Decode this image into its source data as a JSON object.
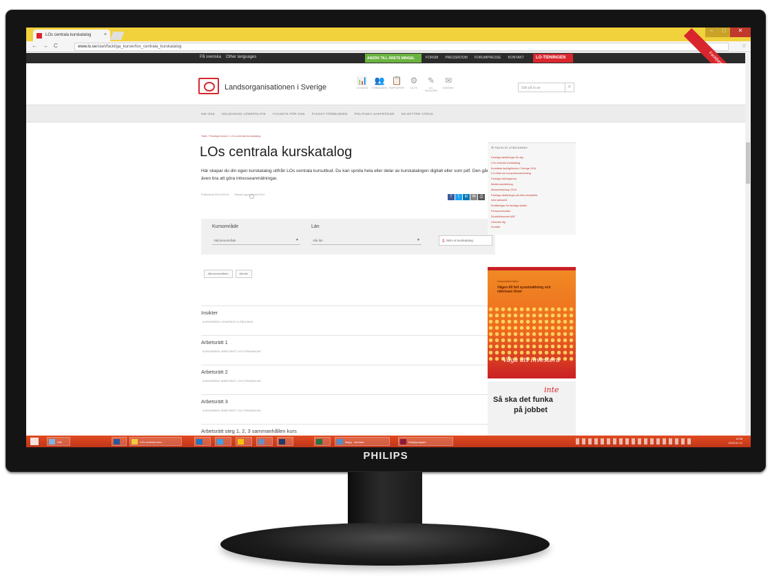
{
  "browser": {
    "tab_title": "LOs centrala kurskatalog",
    "tab_close": "×",
    "url_host": "www.lo.se",
    "url_path": "/start/fackliga_kurser/los_centrala_kurskatalog",
    "nav_back": "←",
    "nav_forward": "→",
    "nav_reload": "C"
  },
  "topbar": {
    "link1": "På svenska",
    "link2": "Other languages",
    "green_button": "ANSÖK TILL ÅRETS MINGEL",
    "links": [
      "FORUM",
      "PRESSROOM",
      "FORUMPRESSE",
      "KONTAKT"
    ],
    "red_button": "LO-TIDNINGEN"
  },
  "ribbon": "Fackfjantakyrkan.se",
  "header": {
    "logo_text": "Landsorganisationen i Sverige",
    "icons": [
      {
        "glyph": "📊",
        "label": "LO-FAKTA"
      },
      {
        "glyph": "👥",
        "label": "FÖRBUNDEN"
      },
      {
        "glyph": "📋",
        "label": "RAPPORTER"
      },
      {
        "glyph": "⚙",
        "label": "LO-TV"
      },
      {
        "glyph": "✎",
        "label": "LO-BLOGGEN"
      },
      {
        "glyph": "✉",
        "label": "KONTAKT"
      }
    ],
    "search_placeholder": "Sök på lo.se",
    "search_icon": "⌕"
  },
  "mainnav": {
    "items": [
      "OM OSS",
      "SOLIDARISK LÖNEPOLITIK",
      "FACKETS FÖR OSS",
      "FACKET FÖRBUNDEN",
      "POLITISKA SAKFRÅGOR",
      "EN BÄTTRE VÄRLD"
    ]
  },
  "content": {
    "breadcrumb": "Start / Fackliga kurser / LOs centrala kurskatalog",
    "title": "LOs centrala kurskatalog",
    "intro": "Här skapar du din egen kurskatalog utifrån LOs centrala kursutbud. Du kan sprida hela eller delar av kurskatalogen digitalt eller som pdf. Den går även bra att göra intresseanmälningar.",
    "meta_left": "Publicerad 2014-09-09",
    "meta_right": "Senast uppdaterad 2014",
    "share_colors": [
      "#3b5998",
      "#1da1f2",
      "#0077b5",
      "#888888",
      "#555555"
    ]
  },
  "filter": {
    "label1": "Kursområde",
    "select1": "Välj kursområde",
    "label2": "Län",
    "select2": "Alla län",
    "caret": "▼",
    "print_label": "Skriv ut kurskatalog",
    "pill1": "Alla kursområden",
    "pill2": "Alla län"
  },
  "courses": [
    {
      "title": "Insikter",
      "sub": "KURSOMRÅDE: LEDARSKAP & UTBILDNING"
    },
    {
      "title": "Arbetsrätt 1",
      "sub": "KURSOMRÅDE: ARBETSRÄTT OCH FÖRHANDLING"
    },
    {
      "title": "Arbetsrätt 2",
      "sub": "KURSOMRÅDE: ARBETSRÄTT OCH FÖRHANDLING"
    },
    {
      "title": "Arbetsrätt 3",
      "sub": "KURSOMRÅDE: ARBETSRÄTT OCH FÖRHANDLING"
    },
    {
      "title": "Arbetsrätt steg 1, 2, 3 sammanhållen kurs",
      "sub": ""
    }
  ],
  "sidebar": {
    "heading": "FACKLIG UTBILDNING",
    "items": [
      "Fackliga utbildningar för dig",
      "LOs centrala kurskatalog",
      "Kursfakta fackligt/skolor i Sverige 2015",
      "LO-rådet om kompetensutveckling",
      "Fackliga folkhögskolor",
      "Medlemsutbildning",
      "Medarbetarskap 2015",
      "Fackliga utbildningar på olika ortsdistrikt",
      "Internationellt",
      "Ersättningar för fackliga studier",
      "Förtroendevalda",
      "Studieförbundet ABF",
      "Utveckla dig",
      "Kontakt"
    ]
  },
  "ads": {
    "ad1_small": "Kampanjinformation",
    "ad1_big": "Vägen till full sysselsättning och rättvisare löner",
    "ad1_script": "Våga att investera",
    "ad2_inte": "inte",
    "ad2_line1": "Så ska det funka",
    "ad2_line2": "på jobbet"
  },
  "taskbar": {
    "items": [
      "Sök",
      "LOs centrala kurs...",
      "Word",
      "Explorer",
      "Foton",
      "Photoshop",
      "Excel",
      "Mapp - skrivare",
      "Kalkylprogram"
    ],
    "time": "10:38",
    "date": "2015-01-12"
  },
  "monitor_brand": "PHILIPS"
}
